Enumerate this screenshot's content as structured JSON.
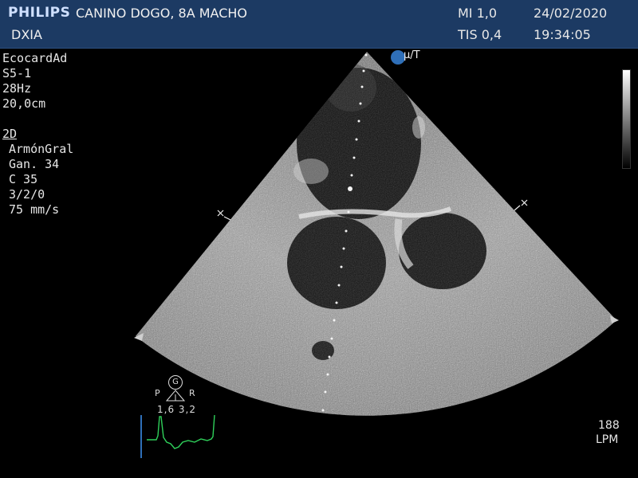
{
  "header": {
    "brand": "PHILIPS",
    "patient": "CANINO DOGO, 8A MACHO",
    "department": "DXIA",
    "mi": "MI 1,0",
    "tis": "TIS 0,4",
    "date": "24/02/2020",
    "time": "19:34:05"
  },
  "params": {
    "preset": "EcocardAd",
    "probe": "S5-1",
    "frame_rate": "28Hz",
    "depth": "20,0cm",
    "mode": "2D",
    "harmonic": "ArmónGral",
    "gain": "Gan. 34",
    "compression": "C 35",
    "persistence": "3/2/0",
    "sweep": "75 mm/s"
  },
  "orientation_marker": "μ/T",
  "physio": {
    "g_icon": "G",
    "p_label": "P",
    "r_label": "R",
    "pr_values": "1,6 3,2"
  },
  "heart_rate": {
    "value": "188",
    "unit": "LPM"
  },
  "colors": {
    "header_bg": "#1c3a63",
    "ecg_trace": "#2fd05a",
    "marker": "#2f6fb8"
  }
}
